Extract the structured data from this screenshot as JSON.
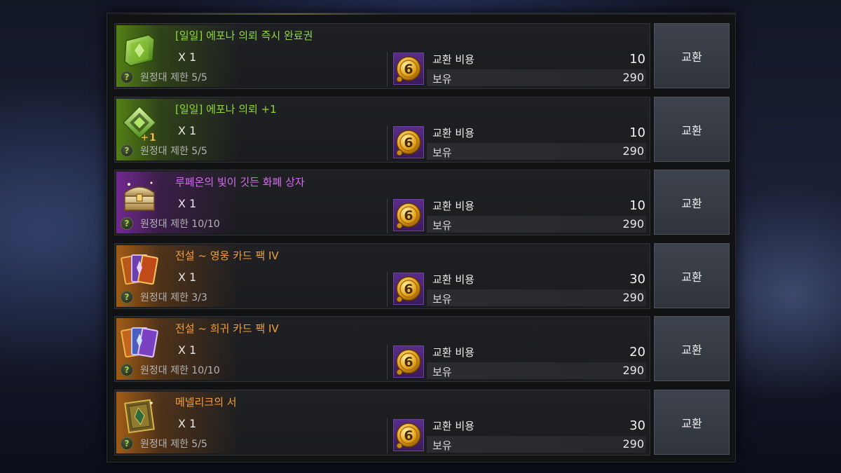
{
  "shop": {
    "exchange_label": "교환",
    "cost_label": "교환 비용",
    "owned_label": "보유",
    "coin_icon": "gold-six-coin-icon",
    "help_icon_glyph": "?",
    "items": [
      {
        "name": "[일일] 에포나 의뢰 즉시 완료권",
        "quantity": "X 1",
        "limit": "원정대 제한 5/5",
        "cost": "10",
        "owned": "290",
        "grade": "green",
        "icon": "green-scroll-icon"
      },
      {
        "name": "[일일] 에포나 의뢰 +1",
        "quantity": "X 1",
        "limit": "원정대 제한 5/5",
        "cost": "10",
        "owned": "290",
        "grade": "green",
        "icon": "green-emblem-plus-icon",
        "badge": "+1"
      },
      {
        "name": "루페온의 빛이 깃든 화폐 상자",
        "quantity": "X 1",
        "limit": "원정대 제한 10/10",
        "cost": "10",
        "owned": "290",
        "grade": "purple",
        "icon": "treasure-chest-icon"
      },
      {
        "name": "전설 ~ 영웅 카드 팩 IV",
        "quantity": "X 1",
        "limit": "원정대 제한 3/3",
        "cost": "30",
        "owned": "290",
        "grade": "orange",
        "icon": "card-pack-icon"
      },
      {
        "name": "전설 ~ 희귀 카드 팩 IV",
        "quantity": "X 1",
        "limit": "원정대 제한 10/10",
        "cost": "20",
        "owned": "290",
        "grade": "orange",
        "icon": "card-pack-rare-icon"
      },
      {
        "name": "메넬리크의 서",
        "quantity": "X 1",
        "limit": "원정대 제한 5/5",
        "cost": "30",
        "owned": "290",
        "grade": "orange",
        "icon": "ancient-book-icon"
      }
    ]
  }
}
